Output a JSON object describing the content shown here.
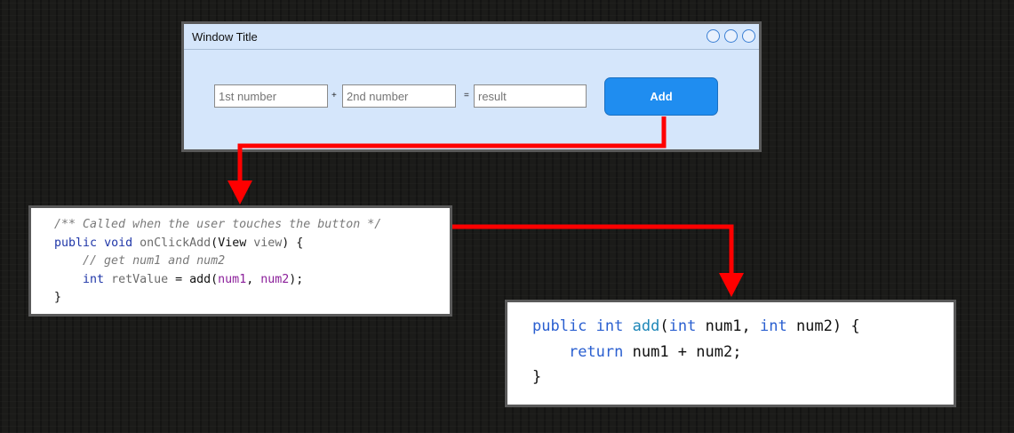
{
  "window": {
    "title": "Window Title",
    "first_placeholder": "1st number",
    "plus": "+",
    "second_placeholder": "2nd number",
    "equals": "=",
    "result_placeholder": "result",
    "add_label": "Add"
  },
  "code1": {
    "comment": "/** Called when the user touches the button */",
    "l2_public": "public",
    "l2_void": "void",
    "l2_name": "onClickAdd",
    "l2_open": "(",
    "l2_type": "View",
    "l2_param": "view",
    "l2_close": ") {",
    "comment2": "// get num1 and num2",
    "l4_int": "int",
    "l4_var": "retValue",
    "l4_eq": " = add(",
    "l4_a": "num1",
    "l4_comma": ", ",
    "l4_b": "num2",
    "l4_end": ");",
    "l5": "}"
  },
  "code2": {
    "public": "public",
    "int1": "int",
    "name": "add",
    "open": "(",
    "int2": "int",
    "p1": " num1, ",
    "int3": "int",
    "p2": " num2) {",
    "ret": "return",
    "expr": " num1 + num2;",
    "close": "}"
  },
  "colors": {
    "arrow": "#ff0000",
    "window_bg": "#d5e6fb",
    "button": "#1f8df0"
  }
}
